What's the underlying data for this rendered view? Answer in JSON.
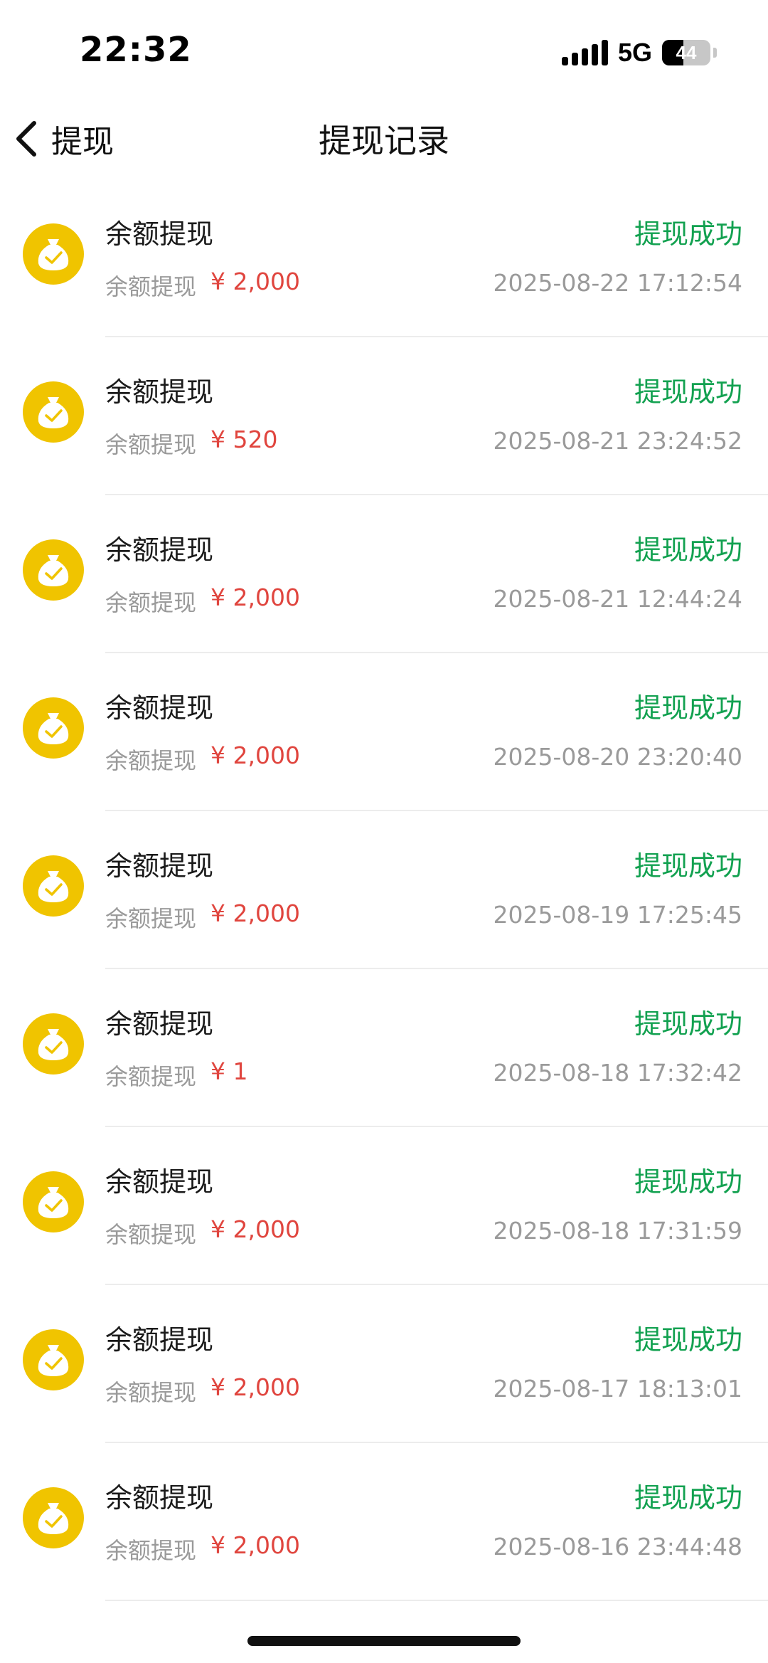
{
  "status_bar": {
    "time": "22:32",
    "network": "5G",
    "battery": "44",
    "battery_level": 0.44
  },
  "nav": {
    "back_label": "提现",
    "title": "提现记录"
  },
  "colors": {
    "icon_bg": "#f0c400",
    "status_success": "#12a150",
    "amount": "#e0453e",
    "secondary_text": "#9a9a9a"
  },
  "records": [
    {
      "title": "余额提现",
      "status": "提现成功",
      "subtitle": "余额提现",
      "amount": "¥ 2,000",
      "time": "2025-08-22 17:12:54"
    },
    {
      "title": "余额提现",
      "status": "提现成功",
      "subtitle": "余额提现",
      "amount": "¥ 520",
      "time": "2025-08-21 23:24:52"
    },
    {
      "title": "余额提现",
      "status": "提现成功",
      "subtitle": "余额提现",
      "amount": "¥ 2,000",
      "time": "2025-08-21 12:44:24"
    },
    {
      "title": "余额提现",
      "status": "提现成功",
      "subtitle": "余额提现",
      "amount": "¥ 2,000",
      "time": "2025-08-20 23:20:40"
    },
    {
      "title": "余额提现",
      "status": "提现成功",
      "subtitle": "余额提现",
      "amount": "¥ 2,000",
      "time": "2025-08-19 17:25:45"
    },
    {
      "title": "余额提现",
      "status": "提现成功",
      "subtitle": "余额提现",
      "amount": "¥ 1",
      "time": "2025-08-18 17:32:42"
    },
    {
      "title": "余额提现",
      "status": "提现成功",
      "subtitle": "余额提现",
      "amount": "¥ 2,000",
      "time": "2025-08-18 17:31:59"
    },
    {
      "title": "余额提现",
      "status": "提现成功",
      "subtitle": "余额提现",
      "amount": "¥ 2,000",
      "time": "2025-08-17 18:13:01"
    },
    {
      "title": "余额提现",
      "status": "提现成功",
      "subtitle": "余额提现",
      "amount": "¥ 2,000",
      "time": "2025-08-16 23:44:48"
    }
  ]
}
